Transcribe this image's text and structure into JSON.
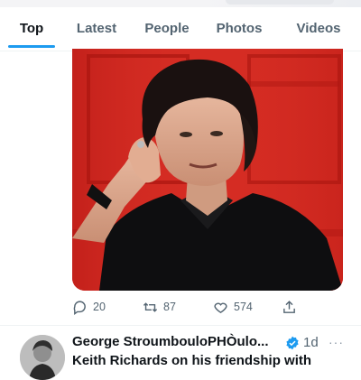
{
  "tabs": [
    {
      "label": "Top",
      "active": true
    },
    {
      "label": "Latest",
      "active": false
    },
    {
      "label": "People",
      "active": false
    },
    {
      "label": "Photos",
      "active": false
    },
    {
      "label": "Videos",
      "active": false
    }
  ],
  "colors": {
    "accent": "#1d9bf0",
    "text_primary": "#0f1419",
    "text_secondary": "#536471",
    "photo_background": "#d21f1b"
  },
  "tweet": {
    "media": {
      "icon": "photo-portrait"
    },
    "actions": {
      "reply": {
        "icon": "reply-icon",
        "count": "20"
      },
      "retweet": {
        "icon": "retweet-icon",
        "count": "87"
      },
      "like": {
        "icon": "heart-icon",
        "count": "574"
      },
      "share": {
        "icon": "share-icon"
      }
    }
  },
  "next_tweet": {
    "author_name": "George StroumbouloPHÒulo...",
    "verified": true,
    "time": "1d",
    "more": "···",
    "text": "Keith Richards on his friendship with"
  }
}
